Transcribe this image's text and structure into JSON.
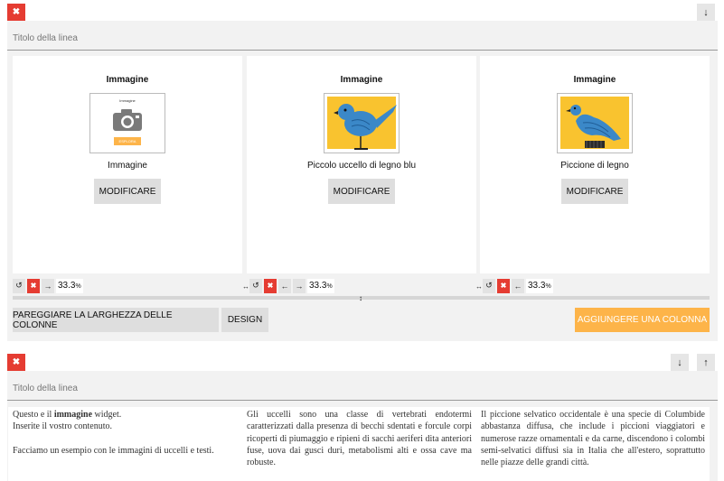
{
  "row1": {
    "title_placeholder": "Titolo della linea",
    "remove_icon": "close-icon",
    "move_down_icon": "arrow-down-icon",
    "columns": [
      {
        "heading": "Immagine",
        "caption": "Immagine",
        "button": "MODIFICARE",
        "width": "33.3",
        "unit": "%",
        "thumb_text": "Immagine",
        "thumb_button": "ESPLORA"
      },
      {
        "heading": "Immagine",
        "caption": "Piccolo uccello di legno blu",
        "button": "MODIFICARE",
        "width": "33.3",
        "unit": "%"
      },
      {
        "heading": "Immagine",
        "caption": "Piccione di legno",
        "button": "MODIFICARE",
        "width": "33.3",
        "unit": "%"
      }
    ],
    "equalize_button": "PAREGGIARE LA LARGHEZZA DELLE COLONNE",
    "design_button": "DESIGN",
    "add_column_button": "AGGIUNGERE UNA COLONNA",
    "colors": {
      "add_button": "#fdb449",
      "remove": "#e53c32",
      "bird_bg": "#f9c32f",
      "bird_blue": "#3b88c8"
    }
  },
  "row2": {
    "title_placeholder": "Titolo della linea",
    "text_col1_line1_pre": "Questo e il ",
    "text_col1_line1_bold": "immagine",
    "text_col1_line1_post": " widget.",
    "text_col1_line2": "Inserite il vostro contenuto.",
    "text_col1_line3": "Facciamo un esempio con le immagini di uccelli e testi.",
    "text_col2": "Gli uccelli sono una classe di vertebrati endotermi caratterizzati dalla presenza di becchi sdentati e forcule corpi ricoperti di piumaggio e ripieni di sacchi aeriferi dita anteriori fuse, uova dai gusci duri, metabolismi alti e ossa cave ma robuste.",
    "text_col3": "Il piccione selvatico occidentale è una specie di Columbide abbastanza diffusa, che include i piccioni viaggiatori e numerose razze ornamentali e da carne, discendono i colombi semi-selvatici diffusi sia in Italia che all'estero, soprattutto nelle piazze delle grandi città."
  }
}
